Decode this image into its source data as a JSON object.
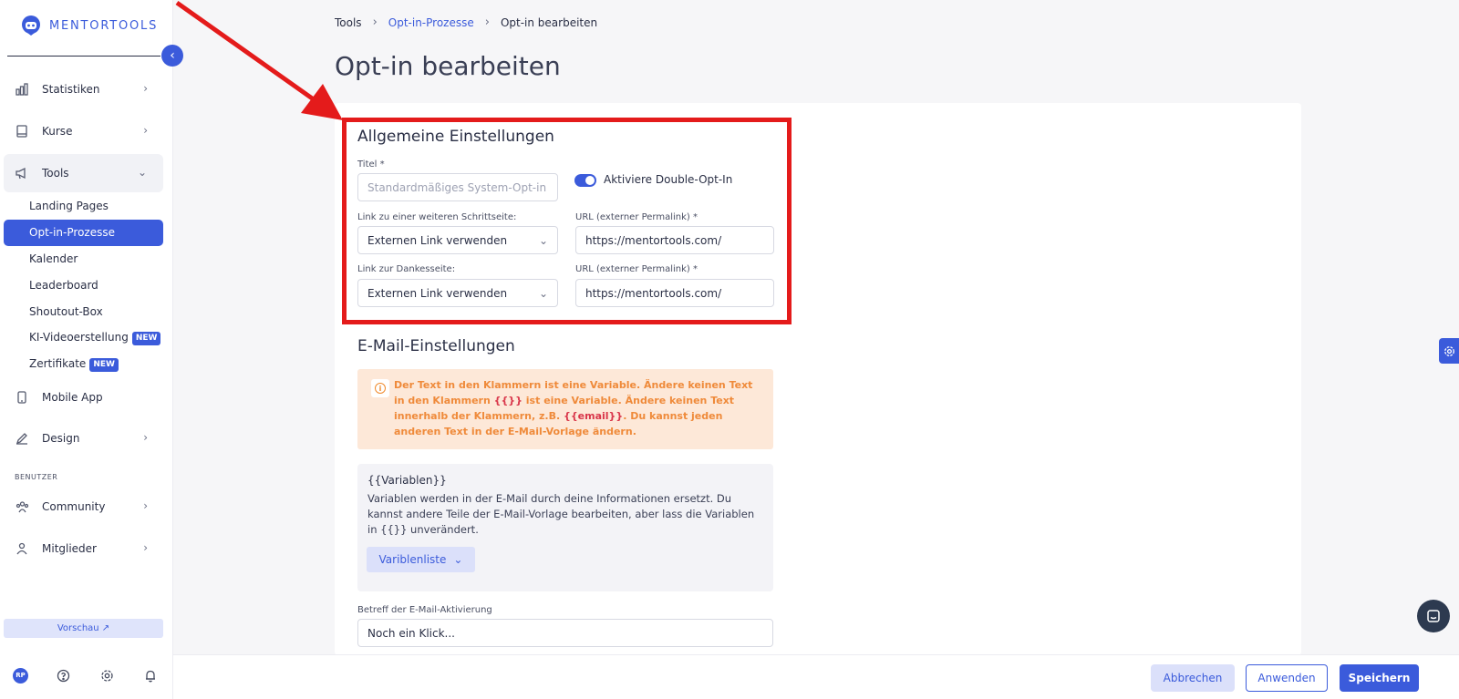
{
  "brand": {
    "name": "MENTORTOOLS",
    "accent": "#3b5bdb"
  },
  "sidebar": {
    "items": [
      {
        "label": "Statistiken",
        "icon": "bar-chart-icon",
        "has_chevron": true
      },
      {
        "label": "Kurse",
        "icon": "book-icon",
        "has_chevron": true
      },
      {
        "label": "Tools",
        "icon": "megaphone-icon",
        "has_chevron": true,
        "expanded": true
      },
      {
        "label": "Mobile App",
        "icon": "phone-icon",
        "has_chevron": false
      },
      {
        "label": "Design",
        "icon": "pencil-icon",
        "has_chevron": true
      }
    ],
    "tools_sub": [
      {
        "label": "Landing Pages"
      },
      {
        "label": "Opt-in-Prozesse",
        "active": true
      },
      {
        "label": "Kalender"
      },
      {
        "label": "Leaderboard"
      },
      {
        "label": "Shoutout-Box"
      },
      {
        "label": "KI-Videoerstellung",
        "badge": "NEW"
      },
      {
        "label": "Zertifikate",
        "badge": "NEW"
      }
    ],
    "section_label": "BENUTZER",
    "user_items": [
      {
        "label": "Community",
        "icon": "users-icon"
      },
      {
        "label": "Mitglieder",
        "icon": "person-icon"
      }
    ],
    "preview_label": "Vorschau ↗",
    "avatar_initials": "RP"
  },
  "breadcrumb": [
    "Tools",
    "Opt-in-Prozesse",
    "Opt-in bearbeiten"
  ],
  "page_title": "Opt-in bearbeiten",
  "general": {
    "title": "Allgemeine Einstellungen",
    "title_label": "Titel *",
    "title_placeholder": "Standardmäßiges System-Opt-in",
    "toggle_label": "Aktiviere Double-Opt-In",
    "toggle_on": true,
    "next_step_label": "Link zu einer weiteren Schrittseite:",
    "next_step_value": "Externen Link verwenden",
    "url1_label": "URL (externer Permalink) *",
    "url1_value": "https://mentortools.com/",
    "thanks_label": "Link zur Dankesseite:",
    "thanks_value": "Externen Link verwenden",
    "url2_label": "URL (externer Permalink) *",
    "url2_value": "https://mentortools.com/"
  },
  "email": {
    "title": "E-Mail-Einstellungen",
    "alert_part1": "Der Text in den Klammern ist eine Variable. Ändere keinen Text in den Klammern ",
    "alert_var1": "{{}}",
    "alert_part2": " ist eine Variable. Ändere keinen Text innerhalb der Klammern, z.B. ",
    "alert_var2": "{{email}}",
    "alert_part3": ". Du kannst jeden anderen Text in der E-Mail-Vorlage ändern.",
    "vars_title": "{{Variablen}}",
    "vars_desc": "Variablen werden in der E-Mail durch deine Informationen ersetzt. Du kannst andere Teile der E-Mail-Vorlage bearbeiten, aber lass die Variablen in {{}} unverändert.",
    "vars_button": "Variblenliste",
    "subject_label": "Betreff der E-Mail-Aktivierung",
    "subject_value": "Noch ein Klick..."
  },
  "footer": {
    "cancel": "Abbrechen",
    "apply": "Anwenden",
    "save": "Speichern"
  }
}
